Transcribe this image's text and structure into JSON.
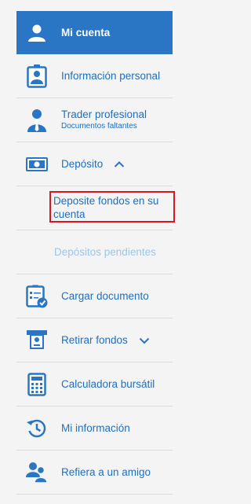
{
  "menu": {
    "account": "Mi cuenta",
    "personal_info": "Información personal",
    "trader": "Trader profesional",
    "trader_sub": "Documentos faltantes",
    "deposit": "Depósito",
    "deposit_funds": "Deposite fondos en su cuenta",
    "pending_deposits": "Depósitos pendientes",
    "upload_doc": "Cargar documento",
    "withdraw": "Retirar fondos",
    "calculator": "Calculadora bursátil",
    "my_info": "Mi información",
    "refer": "Refiera a un amigo"
  },
  "colors": {
    "accent": "#2a75c4",
    "link": "#1f6fbf",
    "muted": "#9cc6ea",
    "highlight": "#e0141e"
  }
}
